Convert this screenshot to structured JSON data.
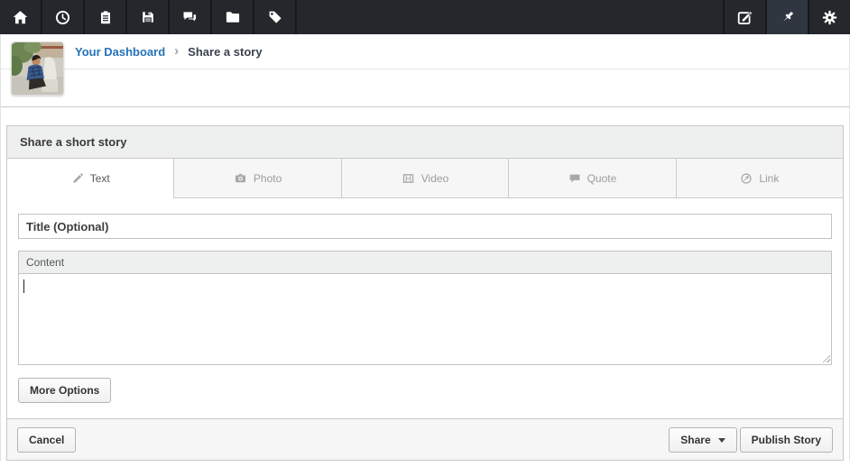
{
  "navbar": {
    "left_icons": [
      "home-icon",
      "history-clock-icon",
      "clipboard-icon",
      "save-floppy-icon",
      "comments-icon",
      "folder-icon",
      "tag-icon"
    ],
    "right_icons": [
      "compose-icon",
      "pin-icon",
      "settings-gear-icon"
    ],
    "active_icon": "pin-icon",
    "colors": {
      "background": "#24282d",
      "active_button": "#2f3640",
      "icon": "#ffffff"
    }
  },
  "breadcrumb": {
    "dashboard_link": "Your Dashboard",
    "separator": "›",
    "current": "Share a story",
    "link_color": "#2572b9"
  },
  "panel": {
    "header": "Share a short story",
    "tabs": [
      {
        "label": "Text",
        "icon": "pencil-icon",
        "active": true
      },
      {
        "label": "Photo",
        "icon": "camera-icon",
        "active": false
      },
      {
        "label": "Video",
        "icon": "film-icon",
        "active": false
      },
      {
        "label": "Quote",
        "icon": "quote-bubble-icon",
        "active": false
      },
      {
        "label": "Link",
        "icon": "link-globe-icon",
        "active": false
      }
    ],
    "title_field": {
      "placeholder": "Title (Optional)",
      "value": ""
    },
    "content_field": {
      "label": "Content",
      "value": ""
    },
    "buttons": {
      "more_options": "More Options",
      "cancel": "Cancel",
      "share": "Share",
      "publish": "Publish Story"
    }
  }
}
